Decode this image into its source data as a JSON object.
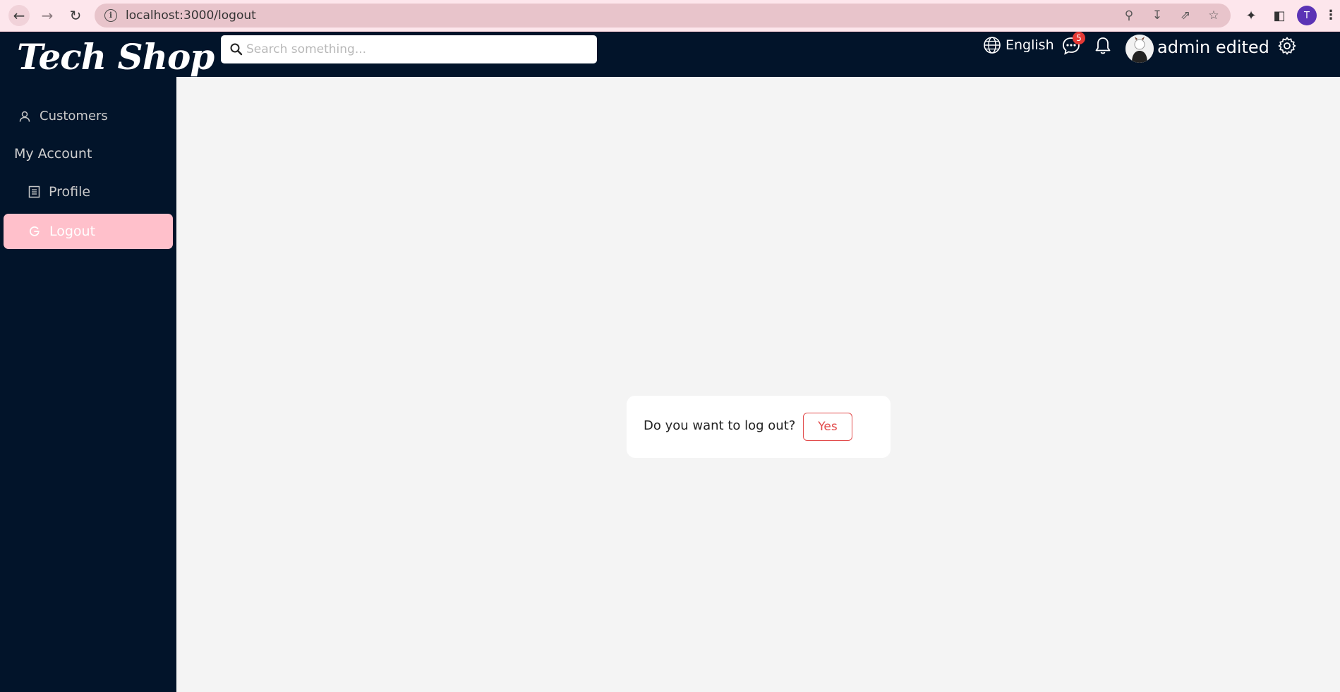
{
  "browser": {
    "url": "localhost:3000/logout",
    "profile_initial": "T"
  },
  "header": {
    "logo": "Tech Shop",
    "search_placeholder": "Search something...",
    "language": "English",
    "chat_badge": "5",
    "user_name": "admin edited"
  },
  "sidebar": {
    "customers": "Customers",
    "section_title": "My Account",
    "profile": "Profile",
    "logout": "Logout"
  },
  "dialog": {
    "question": "Do you want to log out?",
    "confirm": "Yes"
  },
  "colors": {
    "nav_bg": "#02142a",
    "active_item": "#ffc0cb",
    "danger": "#e24b4b",
    "badge": "#e53935",
    "content_bg": "#f4f4f4"
  }
}
